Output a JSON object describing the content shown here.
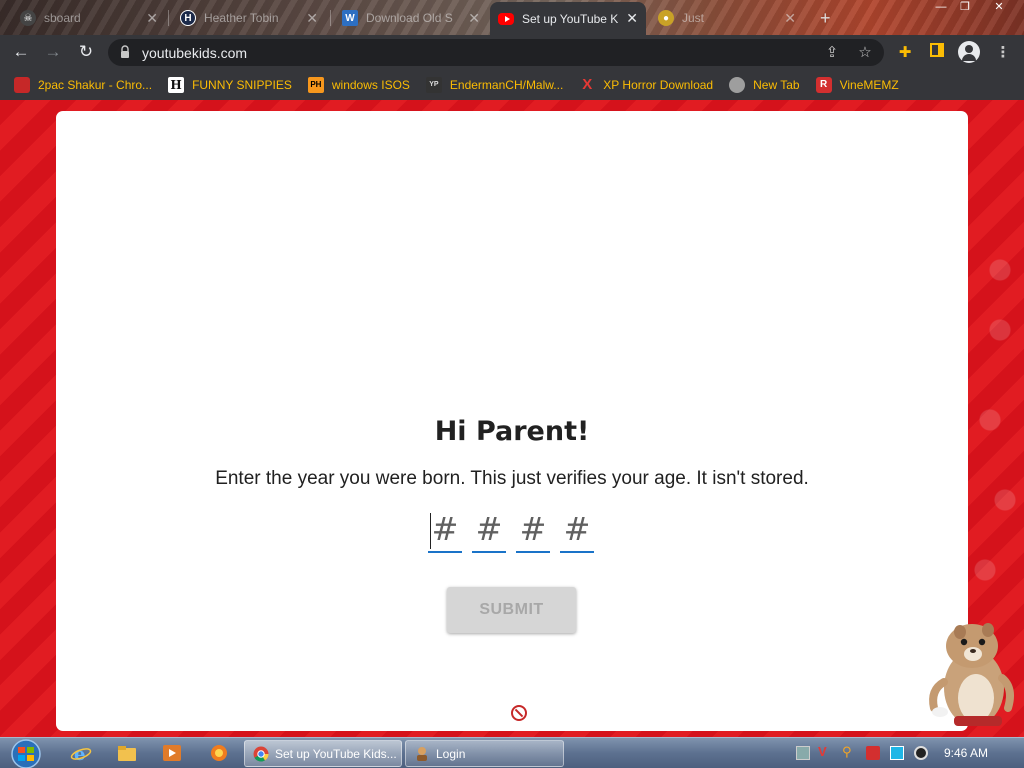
{
  "browser": {
    "tabs": [
      {
        "title": "sboard",
        "favicon": "skull-icon",
        "active": false
      },
      {
        "title": "Heather Tobin",
        "favicon": "h-icon",
        "active": false
      },
      {
        "title": "Download Old S",
        "favicon": "doc-icon",
        "active": false
      },
      {
        "title": "Set up YouTube K",
        "favicon": "youtube-icon",
        "active": true
      },
      {
        "title": "Just",
        "favicon": "globe-icon",
        "active": false
      }
    ],
    "new_tab_symbol": "+",
    "window_controls": {
      "minimize": "—",
      "maximize": "❐",
      "close": "✕"
    },
    "url": "youtubekids.com",
    "bookmarks": [
      {
        "label": "2pac Shakur - Chro...",
        "icon": "app-icon",
        "icon_text": "",
        "color": "#c62828"
      },
      {
        "label": "FUNNY SNIPPIES",
        "icon": "h-icon",
        "icon_text": "H",
        "color": "#ffffff"
      },
      {
        "label": "windows ISOS",
        "icon": "ph-icon",
        "icon_text": "PH",
        "color": "#f7971d"
      },
      {
        "label": "EndermanCH/Malw...",
        "icon": "yp-icon",
        "icon_text": "YP",
        "color": "#333333"
      },
      {
        "label": "XP Horror Download",
        "icon": "x-icon",
        "icon_text": "X",
        "color": "#d32f2f"
      },
      {
        "label": "New Tab",
        "icon": "avatar-icon",
        "icon_text": "",
        "color": "#888888"
      },
      {
        "label": "VineMEMZ",
        "icon": "r-icon",
        "icon_text": "R",
        "color": "#d32f2f"
      }
    ]
  },
  "page": {
    "heading": "Hi Parent!",
    "instruction": "Enter the year you were born. This just verifies your age. It isn't stored.",
    "digit_placeholders": [
      "#",
      "#",
      "#",
      "#"
    ],
    "digit_values": [
      "",
      "",
      "",
      ""
    ],
    "submit_label": "SUBMIT",
    "accent_color": "#1a73c8",
    "background_color": "#e11c22"
  },
  "taskbar": {
    "tasks": [
      {
        "label": "Set up YouTube Kids...",
        "icon": "chrome-icon",
        "active": true
      },
      {
        "label": "Login",
        "icon": "login-icon",
        "active": false
      }
    ],
    "clock": "9:46 AM"
  }
}
